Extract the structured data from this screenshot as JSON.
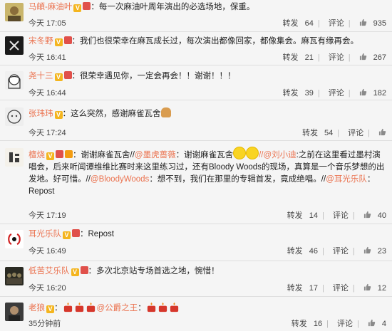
{
  "posts": [
    {
      "name": "马頔-麻油叶",
      "text": "：每一次麻油叶周年演出的必选场地，保重。",
      "time": "今天 17:05",
      "repost_label": "转发",
      "repost_count": "64",
      "comment_label": "评论",
      "like_count": "935"
    },
    {
      "name": "宋冬野",
      "text": "：我们也很荣幸在麻瓦成长过，每次演出都像回家，都像集会。麻瓦有缘再会。",
      "time": "今天 16:41",
      "repost_label": "转发",
      "repost_count": "21",
      "comment_label": "评论",
      "like_count": "267"
    },
    {
      "name": "尧十三",
      "text": "：很荣幸遇见你，一定会再会！！谢谢！！！",
      "time": "今天 16:44",
      "repost_label": "转发",
      "repost_count": "39",
      "comment_label": "评论",
      "like_count": "182"
    },
    {
      "name": "张玮玮",
      "text": "：这么突然，感谢麻雀瓦舍",
      "time": "今天 17:24",
      "repost_label": "转发",
      "repost_count": "54",
      "comment_label": "评论",
      "like_count": ""
    },
    {
      "name": "檀烧",
      "text_a": "：谢谢麻雀瓦舍//",
      "mention_1": "@墨虎蔷薇",
      "text_b": "：谢谢麻雀瓦舍",
      "mention_2": "//@刘小迪",
      "text_c": ":之前在这里看过墨村演唱会，后来听闻谭维维比赛时来这里练习过，还有Bloody Woods的现场，真算是一个音乐梦想的出发地。好可惜。//",
      "mention_3": "@BloodyWoods",
      "text_d": "：想不到，我们在那里的专辑首发，竟成绝唱。//",
      "mention_4": "@耳光乐队",
      "text_e": "：",
      "line2": "Repost",
      "time": "今天 17:19",
      "repost_label": "转发",
      "repost_count": "14",
      "comment_label": "评论",
      "like_count": "40"
    },
    {
      "name": "耳光乐队",
      "text": "：Repost",
      "time": "今天 16:49",
      "repost_label": "转发",
      "repost_count": "46",
      "comment_label": "评论",
      "like_count": "23"
    },
    {
      "name": "低苦艾乐队",
      "text": "：多次北京站专场首选之地，惋惜！",
      "time": "今天 16:20",
      "repost_label": "转发",
      "repost_count": "17",
      "comment_label": "评论",
      "like_count": "12"
    },
    {
      "name": "老狼",
      "text_a": "：",
      "mention": "@公爵之王",
      "text_b": "：",
      "time": "35分钟前",
      "repost_label": "转发",
      "repost_count": "16",
      "comment_label": "评论",
      "like_count": "4"
    }
  ],
  "icons": {
    "like": "thumbs-up-icon",
    "verified": "verified-v-icon",
    "member": "vip-member-icon"
  },
  "colors": {
    "name": "#eb7350",
    "text": "#222222",
    "background": "#f5f5f5"
  }
}
